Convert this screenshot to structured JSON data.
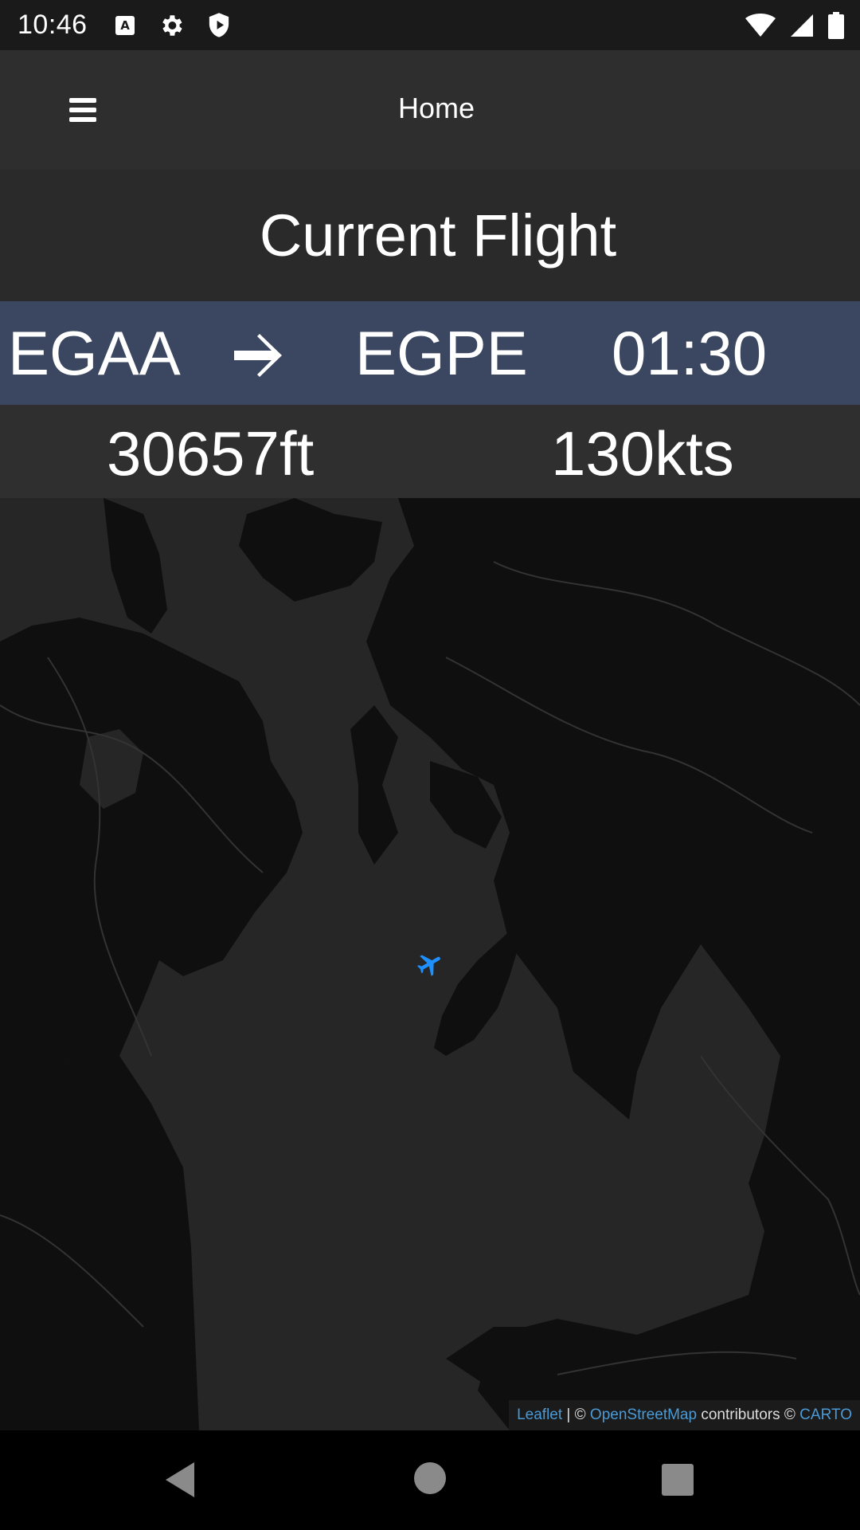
{
  "status_bar": {
    "time": "10:46",
    "left_icons": [
      "a-icon",
      "gear-icon",
      "shield-play-icon"
    ],
    "right_icons": [
      "wifi-icon",
      "signal-icon",
      "battery-icon"
    ]
  },
  "app_bar": {
    "title": "Home",
    "menu_icon": "hamburger-menu-icon"
  },
  "flight": {
    "heading": "Current Flight",
    "origin": "EGAA",
    "destination": "EGPE",
    "time": "01:30",
    "altitude": "30657ft",
    "speed": "130kts",
    "arrow_icon": "arrow-right-icon"
  },
  "map": {
    "marker_icon": "airplane-icon",
    "marker_color": "#1e90ff",
    "attribution": {
      "leaflet": "Leaflet",
      "sep": " | © ",
      "osm": "OpenStreetMap",
      "contributors": " contributors © ",
      "carto": "CARTO"
    }
  },
  "nav_bar": {
    "back_icon": "back-triangle-icon",
    "home_icon": "home-circle-icon",
    "recents_icon": "recents-square-icon"
  }
}
